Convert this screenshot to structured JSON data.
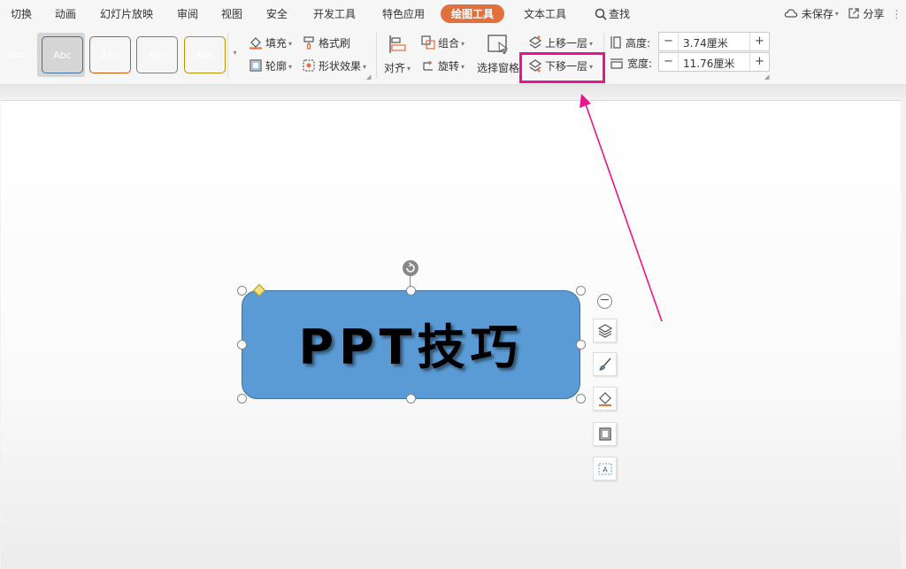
{
  "menu": {
    "tabs": [
      {
        "label": "切换"
      },
      {
        "label": "动画"
      },
      {
        "label": "幻灯片放映"
      },
      {
        "label": "审阅"
      },
      {
        "label": "视图"
      },
      {
        "label": "安全"
      },
      {
        "label": "开发工具"
      },
      {
        "label": "特色应用"
      },
      {
        "label": "绘图工具",
        "active": true
      },
      {
        "label": "文本工具"
      }
    ],
    "search_label": "查找",
    "unsaved_label": "未保存",
    "share_label": "分享"
  },
  "ribbon": {
    "styles": [
      {
        "label": "Abc",
        "color": "#000000"
      },
      {
        "label": "Abc",
        "color": "#5b9bd5"
      },
      {
        "label": "Abc",
        "color": "#ed7d31"
      },
      {
        "label": "Abc",
        "color": "#a5a5a5"
      },
      {
        "label": "Abc",
        "color": "#ffc000"
      }
    ],
    "fill_label": "填充",
    "format_painter_label": "格式刷",
    "outline_label": "轮廓",
    "shape_effect_label": "形状效果",
    "align_label": "对齐",
    "group_label": "组合",
    "rotate_label": "旋转",
    "selection_pane_label": "选择窗格",
    "bring_forward_label": "上移一层",
    "send_backward_label": "下移一层",
    "height_label": "高度:",
    "height_value": "3.74厘米",
    "width_label": "宽度:",
    "width_value": "11.76厘米",
    "minus_symbol": "−",
    "plus_symbol": "+"
  },
  "slide": {
    "shape_text": "PPT技巧",
    "shape_fill": "#5b9bd5",
    "collapse_symbol": "−"
  },
  "colors": {
    "accent": "#e0703d",
    "highlight": "#e8168e"
  }
}
